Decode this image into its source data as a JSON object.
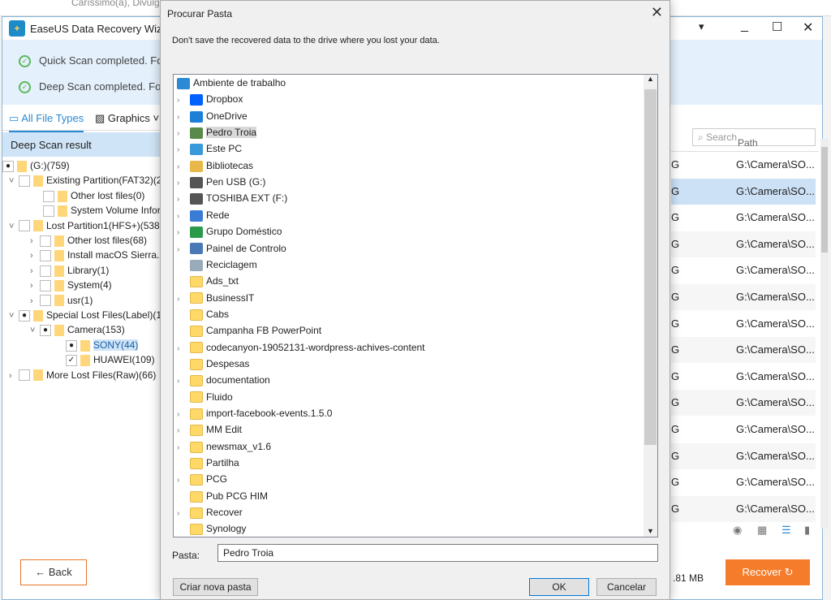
{
  "background_window": {
    "text": "Caríssimo(a), Divulgue"
  },
  "app": {
    "title": "EaseUS Data Recovery Wizard",
    "quick_scan": "Quick Scan completed.  Fou",
    "deep_scan": "Deep Scan completed.  Fou",
    "tabs": [
      "All File Types",
      "Graphics"
    ],
    "deep_scan_result": "Deep Scan result",
    "tree": [
      {
        "label": "(G:)(759)",
        "check": "partial"
      },
      {
        "label": "Existing Partition(FAT32)(2",
        "check": "none",
        "expanded": true
      },
      {
        "label": "Other lost files(0)",
        "check": "none"
      },
      {
        "label": "System Volume Infor",
        "check": "none"
      },
      {
        "label": "Lost Partition1(HFS+)(538",
        "check": "none",
        "expanded": true
      },
      {
        "label": "Other lost files(68)",
        "check": "none"
      },
      {
        "label": "Install macOS Sierra.",
        "check": "none"
      },
      {
        "label": "Library(1)",
        "check": "none"
      },
      {
        "label": "System(4)",
        "check": "none"
      },
      {
        "label": "usr(1)",
        "check": "none"
      },
      {
        "label": "Special Lost Files(Label)(1",
        "check": "partial",
        "expanded": true
      },
      {
        "label": "Camera(153)",
        "check": "partial",
        "expanded": true
      },
      {
        "label": "SONY(44)",
        "check": "partial",
        "selected": true
      },
      {
        "label": "HUAWEI(109)",
        "check": "checked"
      },
      {
        "label": "More Lost Files(Raw)(66)",
        "check": "none"
      }
    ],
    "search_placeholder": "Search",
    "path_header": "Path",
    "rows": [
      {
        "type": "G",
        "path": "G:\\Camera\\SO..."
      },
      {
        "type": "G",
        "path": "G:\\Camera\\SO..."
      },
      {
        "type": "G",
        "path": "G:\\Camera\\SO..."
      },
      {
        "type": "G",
        "path": "G:\\Camera\\SO..."
      },
      {
        "type": "G",
        "path": "G:\\Camera\\SO..."
      },
      {
        "type": "G",
        "path": "G:\\Camera\\SO..."
      },
      {
        "type": "G",
        "path": "G:\\Camera\\SO..."
      },
      {
        "type": "G",
        "path": "G:\\Camera\\SO..."
      },
      {
        "type": "G",
        "path": "G:\\Camera\\SO..."
      },
      {
        "type": "G",
        "path": "G:\\Camera\\SO..."
      },
      {
        "type": "G",
        "path": "G:\\Camera\\SO..."
      },
      {
        "type": "G",
        "path": "G:\\Camera\\SO..."
      },
      {
        "type": "G",
        "path": "G:\\Camera\\SO..."
      },
      {
        "type": "G",
        "path": "G:\\Camera\\SO..."
      }
    ],
    "selected_row": 1,
    "size_text": ".81 MB",
    "back_label": "Back",
    "recover_label": "Recover",
    "accent": "#f57c2b"
  },
  "dialog": {
    "title": "Procurar Pasta",
    "message": "Don't save the recovered data to the drive where you lost your data.",
    "items": [
      {
        "label": "Ambiente de trabalho",
        "icon": "desktop",
        "expander": false,
        "indent": 0
      },
      {
        "label": "Dropbox",
        "icon": "dropbox",
        "expander": true,
        "indent": 1
      },
      {
        "label": "OneDrive",
        "icon": "cloud",
        "expander": true,
        "indent": 1
      },
      {
        "label": "Pedro Troia",
        "icon": "user",
        "expander": true,
        "indent": 1,
        "selected": true
      },
      {
        "label": "Este PC",
        "icon": "computer",
        "expander": true,
        "indent": 1
      },
      {
        "label": "Bibliotecas",
        "icon": "library",
        "expander": true,
        "indent": 1
      },
      {
        "label": "Pen USB (G:)",
        "icon": "drive",
        "expander": true,
        "indent": 1
      },
      {
        "label": "TOSHIBA EXT (F:)",
        "icon": "drive",
        "expander": true,
        "indent": 1
      },
      {
        "label": "Rede",
        "icon": "network",
        "expander": true,
        "indent": 1
      },
      {
        "label": "Grupo Doméstico",
        "icon": "homegroup",
        "expander": true,
        "indent": 1
      },
      {
        "label": "Painel de Controlo",
        "icon": "control-panel",
        "expander": true,
        "indent": 1
      },
      {
        "label": "Reciclagem",
        "icon": "recycle-bin",
        "expander": false,
        "indent": 1
      },
      {
        "label": "Ads_txt",
        "icon": "folder",
        "expander": false,
        "indent": 1
      },
      {
        "label": "BusinessIT",
        "icon": "folder",
        "expander": true,
        "indent": 1
      },
      {
        "label": "Cabs",
        "icon": "folder",
        "expander": false,
        "indent": 1
      },
      {
        "label": "Campanha FB PowerPoint",
        "icon": "folder",
        "expander": false,
        "indent": 1
      },
      {
        "label": "codecanyon-19052131-wordpress-achives-content",
        "icon": "folder",
        "expander": true,
        "indent": 1
      },
      {
        "label": "Despesas",
        "icon": "folder",
        "expander": false,
        "indent": 1
      },
      {
        "label": "documentation",
        "icon": "folder",
        "expander": true,
        "indent": 1
      },
      {
        "label": "Fluido",
        "icon": "folder",
        "expander": false,
        "indent": 1
      },
      {
        "label": "import-facebook-events.1.5.0",
        "icon": "folder",
        "expander": true,
        "indent": 1
      },
      {
        "label": "MM Edit",
        "icon": "folder",
        "expander": true,
        "indent": 1
      },
      {
        "label": "newsmax_v1.6",
        "icon": "folder",
        "expander": true,
        "indent": 1
      },
      {
        "label": "Partilha",
        "icon": "folder",
        "expander": false,
        "indent": 1
      },
      {
        "label": "PCG",
        "icon": "folder",
        "expander": true,
        "indent": 1
      },
      {
        "label": "Pub PCG HIM",
        "icon": "folder",
        "expander": false,
        "indent": 1
      },
      {
        "label": "Recover",
        "icon": "folder",
        "expander": true,
        "indent": 1
      },
      {
        "label": "Synology",
        "icon": "folder",
        "expander": false,
        "indent": 1
      }
    ],
    "pasta_label": "Pasta:",
    "pasta_value": "Pedro Troia",
    "new_folder": "Criar nova pasta",
    "ok": "OK",
    "cancel": "Cancelar"
  }
}
